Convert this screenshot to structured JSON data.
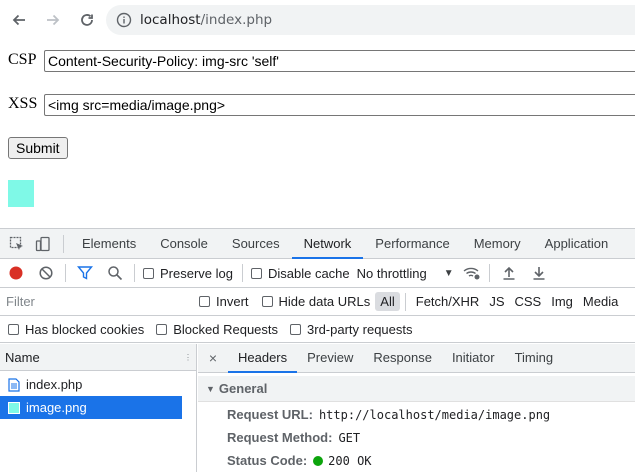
{
  "browser": {
    "url_host": "localhost",
    "url_path": "/index.php"
  },
  "page": {
    "csp_label": "CSP",
    "csp_value": "Content-Security-Policy: img-src 'self'",
    "xss_label": "XSS",
    "xss_value": "<img src=media/image.png>",
    "submit_label": "Submit",
    "image_color": "#7ff9e7"
  },
  "devtools": {
    "tabs": [
      "Elements",
      "Console",
      "Sources",
      "Network",
      "Performance",
      "Memory",
      "Application"
    ],
    "active_tab": "Network",
    "toolbar": {
      "preserve_log": "Preserve log",
      "disable_cache": "Disable cache",
      "throttling": "No throttling"
    },
    "filter": {
      "placeholder": "Filter",
      "invert": "Invert",
      "hide_data_urls": "Hide data URLs",
      "types": [
        "All",
        "Fetch/XHR",
        "JS",
        "CSS",
        "Img",
        "Media"
      ],
      "selected_type": "All"
    },
    "blocked": {
      "has_blocked_cookies": "Has blocked cookies",
      "blocked_requests": "Blocked Requests",
      "third_party": "3rd-party requests"
    },
    "request_list": {
      "header": "Name",
      "rows": [
        {
          "name": "index.php",
          "icon": "document-icon",
          "selected": false
        },
        {
          "name": "image.png",
          "icon": "image-icon",
          "selected": true
        }
      ]
    },
    "detail": {
      "close": "×",
      "tabs": [
        "Headers",
        "Preview",
        "Response",
        "Initiator",
        "Timing"
      ],
      "active_tab": "Headers",
      "section": "General",
      "request_url_label": "Request URL:",
      "request_url": "http://localhost/media/image.png",
      "request_method_label": "Request Method:",
      "request_method": "GET",
      "status_code_label": "Status Code:",
      "status_code": "200 OK"
    }
  },
  "colors": {
    "accent": "#1a73e8",
    "record": "#d93025",
    "status_ok": "#0ca40c"
  }
}
